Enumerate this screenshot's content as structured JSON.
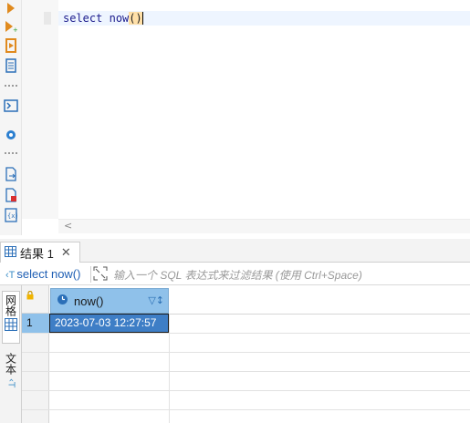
{
  "editor": {
    "sql_keyword": "select",
    "sql_function": "now",
    "sql_parens": "()"
  },
  "toolbar": {
    "icons": [
      "run-icon",
      "run-new-tab-icon",
      "execute-script-icon",
      "explain-plan-icon",
      "terminal-icon",
      "settings-icon",
      "export-icon",
      "save-script-icon",
      "variables-icon"
    ]
  },
  "results": {
    "tab_label": "结果 1",
    "query_label": "select now()",
    "filter_placeholder": "输入一个 SQL 表达式来过滤结果 (使用 Ctrl+Space)",
    "side_tabs": {
      "grid_label": "网格",
      "text_label": "文本"
    },
    "columns": [
      "now()"
    ],
    "rows": [
      {
        "num": "1",
        "cells": [
          "2023-07-03 12:27:57"
        ]
      }
    ]
  },
  "colors": {
    "accent": "#e08a1e",
    "header_blue": "#8fc1ea",
    "selected_cell": "#3e7ec6"
  }
}
